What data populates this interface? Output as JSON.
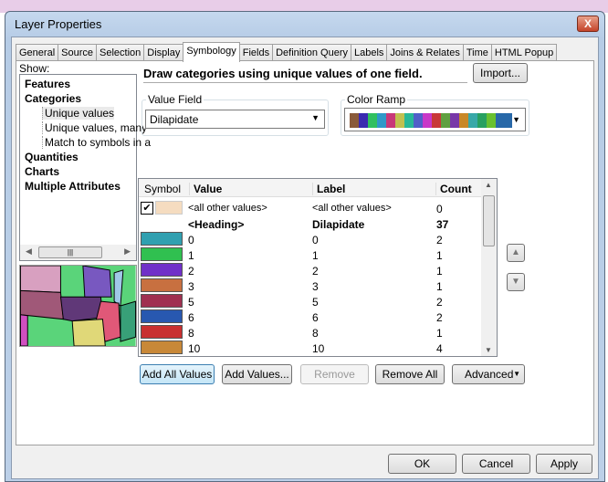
{
  "window": {
    "title": "Layer Properties",
    "close": "X"
  },
  "tabs": [
    "General",
    "Source",
    "Selection",
    "Display",
    "Symbology",
    "Fields",
    "Definition Query",
    "Labels",
    "Joins & Relates",
    "Time",
    "HTML Popup"
  ],
  "active_tab": "Symbology",
  "show": {
    "label": "Show:",
    "items": [
      {
        "label": "Features",
        "bold": true
      },
      {
        "label": "Categories",
        "bold": true
      },
      {
        "label": "Unique values",
        "bold": false,
        "selected": true
      },
      {
        "label": "Unique values, many",
        "bold": false
      },
      {
        "label": "Match to symbols in a",
        "bold": false
      },
      {
        "label": "Quantities",
        "bold": true
      },
      {
        "label": "Charts",
        "bold": true
      },
      {
        "label": "Multiple Attributes",
        "bold": true
      }
    ]
  },
  "description": "Draw categories using unique values of one field.",
  "import_label": "Import...",
  "value_field": {
    "label": "Value Field",
    "value": "Dilapidate"
  },
  "color_ramp": {
    "label": "Color Ramp",
    "colors": [
      "#8a5a3a",
      "#3a2ab0",
      "#30c060",
      "#3098c8",
      "#c83878",
      "#c0c050",
      "#28b898",
      "#5060c8",
      "#c838c8",
      "#c83838",
      "#60a040",
      "#7838a8",
      "#c88828",
      "#38a8a8",
      "#28a060",
      "#68c030",
      "#2868a8"
    ]
  },
  "table": {
    "headers": [
      "Symbol",
      "Value",
      "Label",
      "Count"
    ],
    "rows": [
      {
        "color": "#f5dcc0",
        "value": "<all other values>",
        "label": "<all other values>",
        "count": "0",
        "checked": true
      },
      {
        "color": null,
        "value": "<Heading>",
        "label": "Dilapidate",
        "count": "37",
        "heading": true
      },
      {
        "color": "#30a0b0",
        "value": "0",
        "label": "0",
        "count": "2"
      },
      {
        "color": "#30c050",
        "value": "1",
        "label": "1",
        "count": "1"
      },
      {
        "color": "#7030c8",
        "value": "2",
        "label": "2",
        "count": "1"
      },
      {
        "color": "#c87040",
        "value": "3",
        "label": "3",
        "count": "1"
      },
      {
        "color": "#a03050",
        "value": "5",
        "label": "5",
        "count": "2"
      },
      {
        "color": "#2858b0",
        "value": "6",
        "label": "6",
        "count": "2"
      },
      {
        "color": "#c83030",
        "value": "8",
        "label": "8",
        "count": "1"
      },
      {
        "color": "#c88838",
        "value": "10",
        "label": "10",
        "count": "4"
      }
    ]
  },
  "buttons": {
    "add_all": "Add All Values",
    "add": "Add Values...",
    "remove": "Remove",
    "remove_all": "Remove All",
    "advanced": "Advanced"
  },
  "footer": {
    "ok": "OK",
    "cancel": "Cancel",
    "apply": "Apply"
  }
}
